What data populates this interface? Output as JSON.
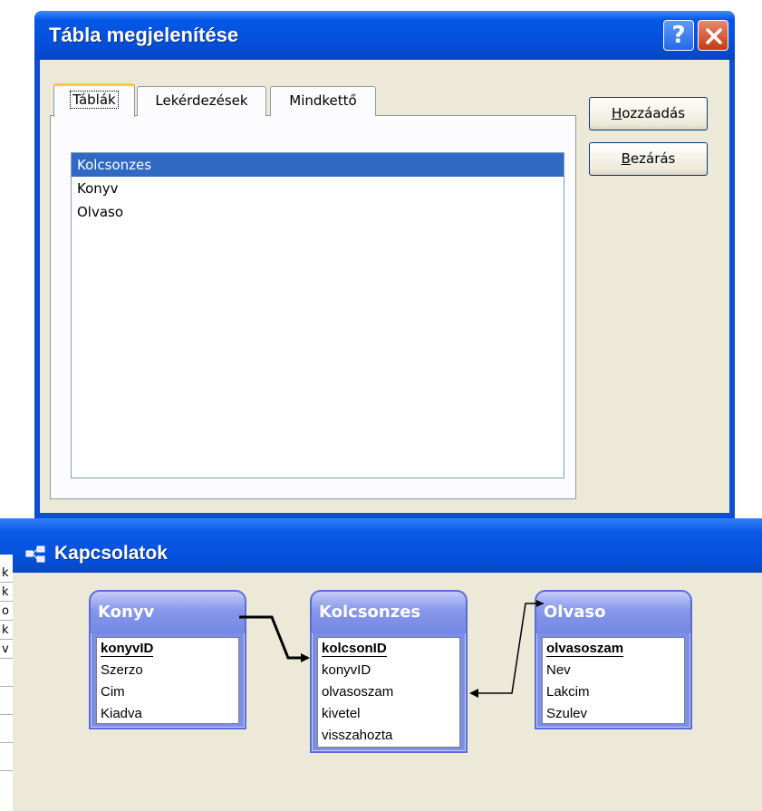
{
  "dialog1": {
    "title": "Tábla megjelenítése",
    "help_label": "?",
    "tabs": [
      {
        "label": "Táblák"
      },
      {
        "label": "Lekérdezések"
      },
      {
        "label": "Mindkettő"
      }
    ],
    "list_items": [
      "Kolcsonzes",
      "Konyv",
      "Olvaso"
    ],
    "selected_item": "Kolcsonzes",
    "buttons": {
      "add": {
        "accel": "H",
        "rest": "ozzáadás"
      },
      "close": {
        "accel": "B",
        "rest": "ezárás"
      }
    }
  },
  "dialog2": {
    "title": "Kapcsolatok",
    "strip_chars": [
      "k",
      "k",
      "o",
      "k",
      "v"
    ],
    "tables": [
      {
        "name": "Konyv",
        "fields": [
          "konyvID",
          "Szerzo",
          "Cim",
          "Kiadva"
        ],
        "key": "konyvID"
      },
      {
        "name": "Kolcsonzes",
        "fields": [
          "kolcsonID",
          "konyvID",
          "olvasoszam",
          "kivetel",
          "visszahozta"
        ],
        "key": "kolcsonID"
      },
      {
        "name": "Olvaso",
        "fields": [
          "olvasoszam",
          "Nev",
          "Lakcim",
          "Szulev"
        ],
        "key": "olvasoszam"
      }
    ]
  },
  "colors": {
    "titlebar": "#0551dd",
    "selection": "#316ac5",
    "dialog_face": "#ece9d8",
    "table_header": "#7c8fe6",
    "close_button": "#c53a13"
  },
  "icons": [
    "help-icon",
    "close-icon",
    "relationships-icon"
  ]
}
